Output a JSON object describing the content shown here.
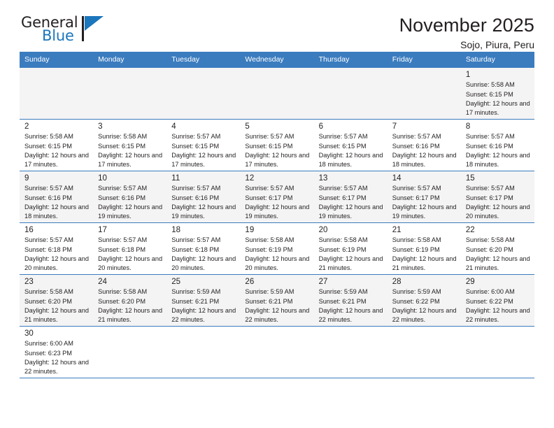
{
  "brand": {
    "name_top": "General",
    "name_bottom": "Blue",
    "accent_color": "#1b76bc"
  },
  "header": {
    "title": "November 2025",
    "subtitle": "Sojo, Piura, Peru"
  },
  "theme": {
    "header_bg": "#3b7cbf",
    "header_text": "#ffffff",
    "row_shade": "#f4f4f4",
    "text": "#231f20"
  },
  "labels": {
    "sunrise_prefix": "Sunrise:",
    "sunset_prefix": "Sunset:",
    "daylight_prefix": "Daylight:"
  },
  "weekdays": [
    "Sunday",
    "Monday",
    "Tuesday",
    "Wednesday",
    "Thursday",
    "Friday",
    "Saturday"
  ],
  "weeks": [
    [
      null,
      null,
      null,
      null,
      null,
      null,
      {
        "day": "1",
        "sunrise": "Sunrise: 5:58 AM",
        "sunset": "Sunset: 6:15 PM",
        "daylight": "Daylight: 12 hours and 17 minutes."
      }
    ],
    [
      {
        "day": "2",
        "sunrise": "Sunrise: 5:58 AM",
        "sunset": "Sunset: 6:15 PM",
        "daylight": "Daylight: 12 hours and 17 minutes."
      },
      {
        "day": "3",
        "sunrise": "Sunrise: 5:58 AM",
        "sunset": "Sunset: 6:15 PM",
        "daylight": "Daylight: 12 hours and 17 minutes."
      },
      {
        "day": "4",
        "sunrise": "Sunrise: 5:57 AM",
        "sunset": "Sunset: 6:15 PM",
        "daylight": "Daylight: 12 hours and 17 minutes."
      },
      {
        "day": "5",
        "sunrise": "Sunrise: 5:57 AM",
        "sunset": "Sunset: 6:15 PM",
        "daylight": "Daylight: 12 hours and 17 minutes."
      },
      {
        "day": "6",
        "sunrise": "Sunrise: 5:57 AM",
        "sunset": "Sunset: 6:15 PM",
        "daylight": "Daylight: 12 hours and 18 minutes."
      },
      {
        "day": "7",
        "sunrise": "Sunrise: 5:57 AM",
        "sunset": "Sunset: 6:16 PM",
        "daylight": "Daylight: 12 hours and 18 minutes."
      },
      {
        "day": "8",
        "sunrise": "Sunrise: 5:57 AM",
        "sunset": "Sunset: 6:16 PM",
        "daylight": "Daylight: 12 hours and 18 minutes."
      }
    ],
    [
      {
        "day": "9",
        "sunrise": "Sunrise: 5:57 AM",
        "sunset": "Sunset: 6:16 PM",
        "daylight": "Daylight: 12 hours and 18 minutes."
      },
      {
        "day": "10",
        "sunrise": "Sunrise: 5:57 AM",
        "sunset": "Sunset: 6:16 PM",
        "daylight": "Daylight: 12 hours and 19 minutes."
      },
      {
        "day": "11",
        "sunrise": "Sunrise: 5:57 AM",
        "sunset": "Sunset: 6:16 PM",
        "daylight": "Daylight: 12 hours and 19 minutes."
      },
      {
        "day": "12",
        "sunrise": "Sunrise: 5:57 AM",
        "sunset": "Sunset: 6:17 PM",
        "daylight": "Daylight: 12 hours and 19 minutes."
      },
      {
        "day": "13",
        "sunrise": "Sunrise: 5:57 AM",
        "sunset": "Sunset: 6:17 PM",
        "daylight": "Daylight: 12 hours and 19 minutes."
      },
      {
        "day": "14",
        "sunrise": "Sunrise: 5:57 AM",
        "sunset": "Sunset: 6:17 PM",
        "daylight": "Daylight: 12 hours and 19 minutes."
      },
      {
        "day": "15",
        "sunrise": "Sunrise: 5:57 AM",
        "sunset": "Sunset: 6:17 PM",
        "daylight": "Daylight: 12 hours and 20 minutes."
      }
    ],
    [
      {
        "day": "16",
        "sunrise": "Sunrise: 5:57 AM",
        "sunset": "Sunset: 6:18 PM",
        "daylight": "Daylight: 12 hours and 20 minutes."
      },
      {
        "day": "17",
        "sunrise": "Sunrise: 5:57 AM",
        "sunset": "Sunset: 6:18 PM",
        "daylight": "Daylight: 12 hours and 20 minutes."
      },
      {
        "day": "18",
        "sunrise": "Sunrise: 5:57 AM",
        "sunset": "Sunset: 6:18 PM",
        "daylight": "Daylight: 12 hours and 20 minutes."
      },
      {
        "day": "19",
        "sunrise": "Sunrise: 5:58 AM",
        "sunset": "Sunset: 6:19 PM",
        "daylight": "Daylight: 12 hours and 20 minutes."
      },
      {
        "day": "20",
        "sunrise": "Sunrise: 5:58 AM",
        "sunset": "Sunset: 6:19 PM",
        "daylight": "Daylight: 12 hours and 21 minutes."
      },
      {
        "day": "21",
        "sunrise": "Sunrise: 5:58 AM",
        "sunset": "Sunset: 6:19 PM",
        "daylight": "Daylight: 12 hours and 21 minutes."
      },
      {
        "day": "22",
        "sunrise": "Sunrise: 5:58 AM",
        "sunset": "Sunset: 6:20 PM",
        "daylight": "Daylight: 12 hours and 21 minutes."
      }
    ],
    [
      {
        "day": "23",
        "sunrise": "Sunrise: 5:58 AM",
        "sunset": "Sunset: 6:20 PM",
        "daylight": "Daylight: 12 hours and 21 minutes."
      },
      {
        "day": "24",
        "sunrise": "Sunrise: 5:58 AM",
        "sunset": "Sunset: 6:20 PM",
        "daylight": "Daylight: 12 hours and 21 minutes."
      },
      {
        "day": "25",
        "sunrise": "Sunrise: 5:59 AM",
        "sunset": "Sunset: 6:21 PM",
        "daylight": "Daylight: 12 hours and 22 minutes."
      },
      {
        "day": "26",
        "sunrise": "Sunrise: 5:59 AM",
        "sunset": "Sunset: 6:21 PM",
        "daylight": "Daylight: 12 hours and 22 minutes."
      },
      {
        "day": "27",
        "sunrise": "Sunrise: 5:59 AM",
        "sunset": "Sunset: 6:21 PM",
        "daylight": "Daylight: 12 hours and 22 minutes."
      },
      {
        "day": "28",
        "sunrise": "Sunrise: 5:59 AM",
        "sunset": "Sunset: 6:22 PM",
        "daylight": "Daylight: 12 hours and 22 minutes."
      },
      {
        "day": "29",
        "sunrise": "Sunrise: 6:00 AM",
        "sunset": "Sunset: 6:22 PM",
        "daylight": "Daylight: 12 hours and 22 minutes."
      }
    ],
    [
      {
        "day": "30",
        "sunrise": "Sunrise: 6:00 AM",
        "sunset": "Sunset: 6:23 PM",
        "daylight": "Daylight: 12 hours and 22 minutes."
      },
      null,
      null,
      null,
      null,
      null,
      null
    ]
  ]
}
